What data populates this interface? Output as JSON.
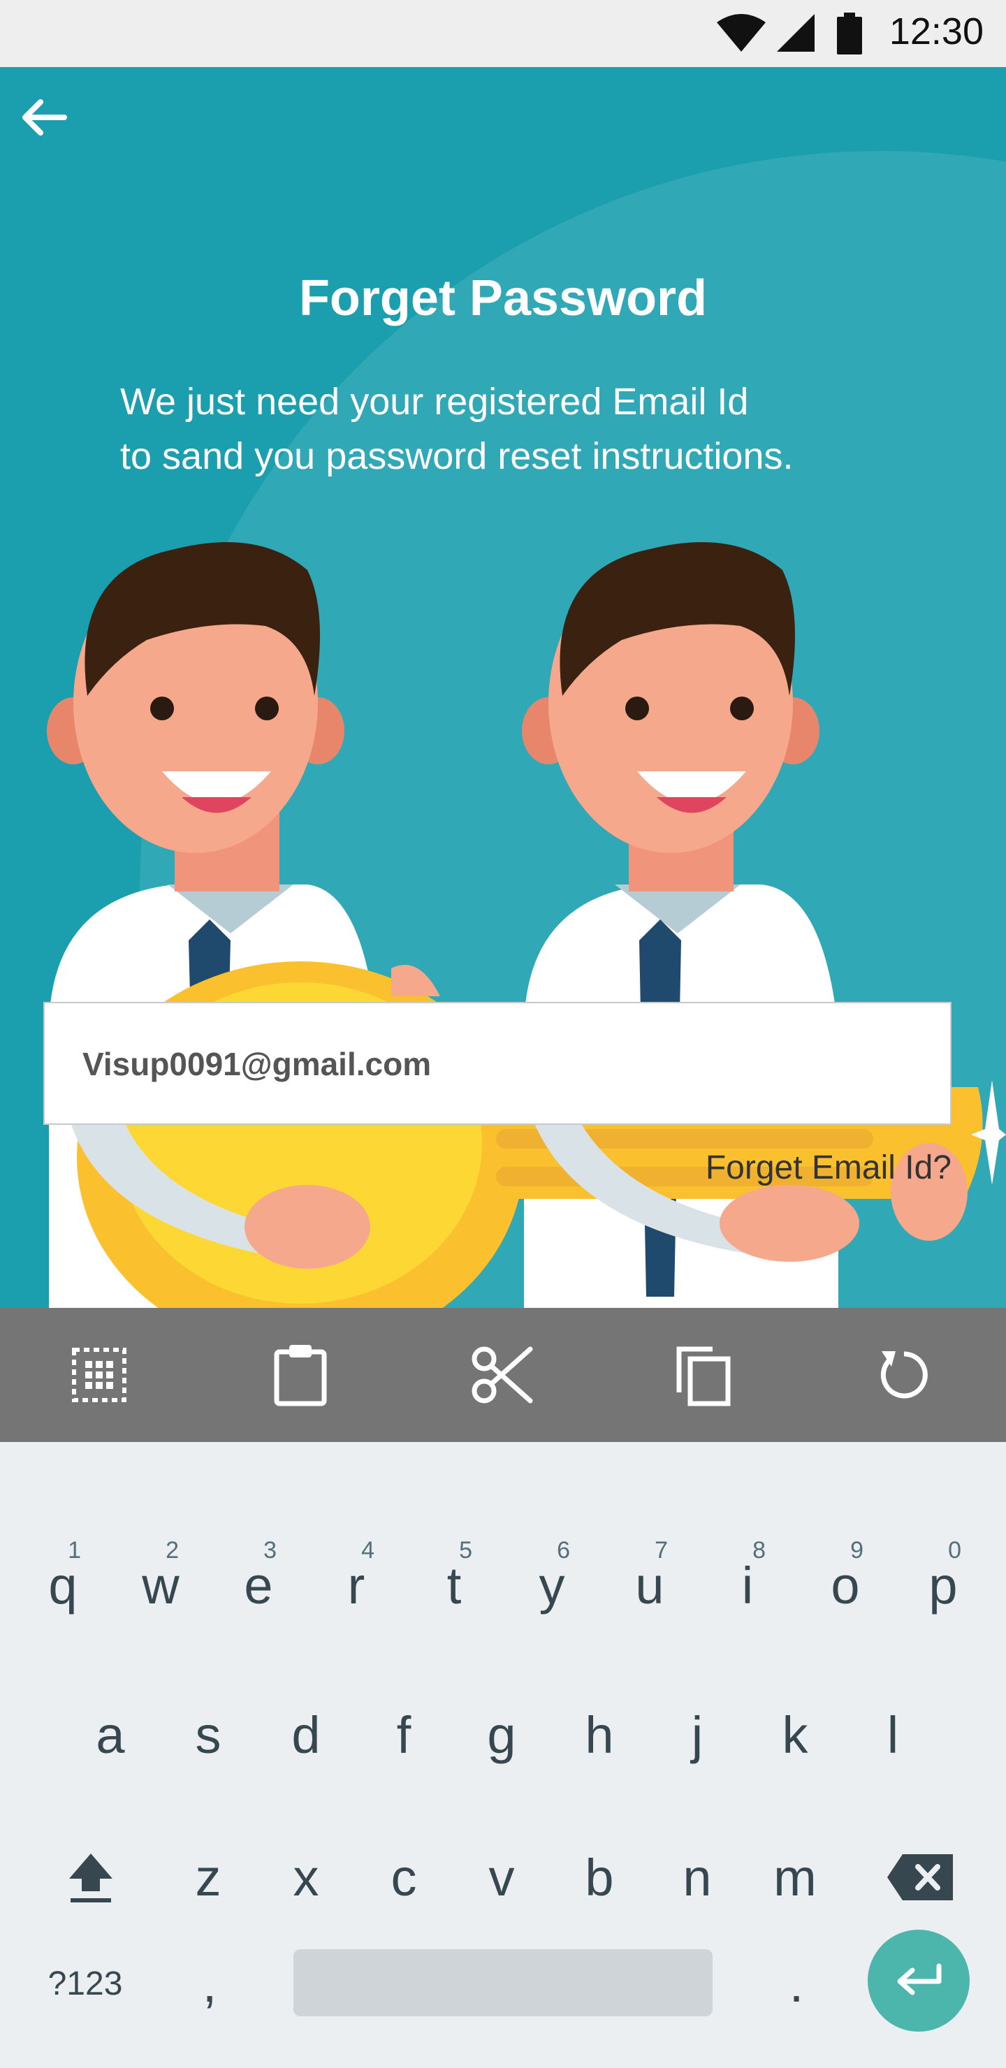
{
  "status_bar": {
    "time": "12:30"
  },
  "page": {
    "title": "Forget Password",
    "subtitle_line1": "We just need your registered Email Id",
    "subtitle_line2": "to sand you password reset instructions.",
    "email_value": "Visup0091@gmail.com",
    "forgot_link": "Forget Email Id?"
  },
  "colors": {
    "hero_bg": "#1b9eae",
    "toolbar_bg": "#757575",
    "enter_key": "#4db6ac"
  },
  "toolbar": {
    "icons": [
      "select-all-icon",
      "paste-icon",
      "cut-icon",
      "copy-icon",
      "undo-icon"
    ]
  },
  "keyboard": {
    "row1": [
      "q",
      "w",
      "e",
      "r",
      "t",
      "y",
      "u",
      "i",
      "o",
      "p"
    ],
    "row1_hints": [
      "1",
      "2",
      "3",
      "4",
      "5",
      "6",
      "7",
      "8",
      "9",
      "0"
    ],
    "row2": [
      "a",
      "s",
      "d",
      "f",
      "g",
      "h",
      "j",
      "k",
      "l"
    ],
    "row3": [
      "z",
      "x",
      "c",
      "v",
      "b",
      "n",
      "m"
    ],
    "symbols_label": "?123",
    "comma": ",",
    "period": "."
  }
}
